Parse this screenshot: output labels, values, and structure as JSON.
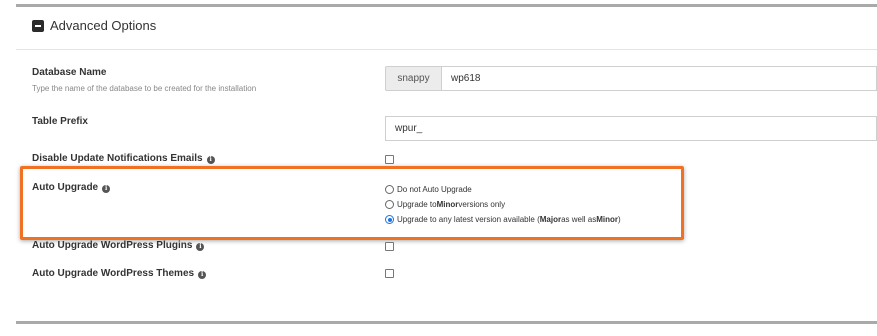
{
  "section": {
    "title": "Advanced Options"
  },
  "database": {
    "label": "Database Name",
    "description": "Type the name of the database to be created for the installation",
    "prefix": "snappy",
    "value": "wp618"
  },
  "table_prefix": {
    "label": "Table Prefix",
    "value": "wpur_"
  },
  "disable_notifications": {
    "label": "Disable Update Notifications Emails",
    "checked": false
  },
  "auto_upgrade": {
    "label": "Auto Upgrade",
    "options": [
      {
        "parts": [
          "Do not Auto Upgrade"
        ],
        "selected": false
      },
      {
        "parts": [
          "Upgrade to ",
          "Minor",
          " versions only"
        ],
        "selected": false
      },
      {
        "parts": [
          "Upgrade to any latest version available (",
          "Major",
          " as well as ",
          "Minor",
          ")"
        ],
        "selected": true
      }
    ]
  },
  "auto_upgrade_plugins": {
    "label": "Auto Upgrade WordPress Plugins",
    "checked": false
  },
  "auto_upgrade_themes": {
    "label": "Auto Upgrade WordPress Themes",
    "checked": false
  },
  "colors": {
    "highlight": "#f07124",
    "radio_selected": "#1a73e8"
  },
  "icons": {
    "section_toggle": "minus-square-icon",
    "info": "info-circle-icon"
  }
}
